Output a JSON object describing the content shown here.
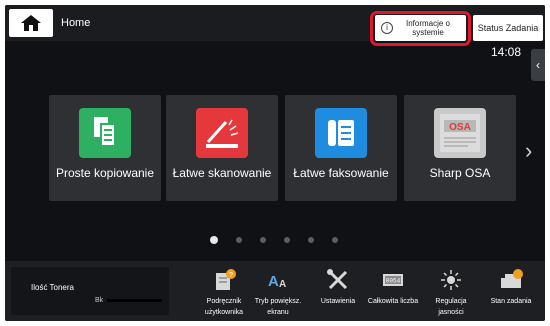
{
  "header": {
    "home_label": "Home",
    "system_info_label": "Informacje o systemie",
    "job_status_label": "Status Zadania",
    "clock": "14:08"
  },
  "tiles": [
    {
      "label": "Proste kopiowanie",
      "icon": "copy-icon",
      "color": "#2db062"
    },
    {
      "label": "Łatwe skanowanie",
      "icon": "scanner-icon",
      "color": "#e4383c"
    },
    {
      "label": "Łatwe faksowanie",
      "icon": "fax-icon",
      "color": "#1e8de0"
    },
    {
      "label": "Sharp OSA",
      "icon": "sharp-osa-icon",
      "color": "#c9c9c9"
    }
  ],
  "pager": {
    "pages": 6,
    "current": 1
  },
  "toner": {
    "label": "Ilość Tonera",
    "channel": "Bk"
  },
  "quick_actions": [
    {
      "label": "Podręcznik użytkownika",
      "icon": "manual-icon"
    },
    {
      "label": "Tryb powiększ. ekranu",
      "icon": "font-size-icon"
    },
    {
      "label": "Ustawienia",
      "icon": "tools-icon"
    },
    {
      "label": "Całkowita liczba",
      "icon": "counter-icon"
    },
    {
      "label": "Regulacja jasności",
      "icon": "brightness-icon"
    },
    {
      "label": "Stan zadania",
      "icon": "job-status-icon"
    }
  ],
  "colors": {
    "highlight": "#e0182d",
    "background": "#0f1114"
  }
}
